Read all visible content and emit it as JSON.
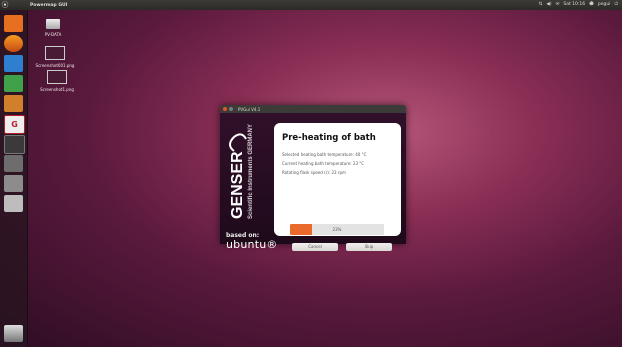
{
  "topbar": {
    "app_title": "Powermap GUI",
    "tray_text": "Sat 10:16",
    "user": "pegui"
  },
  "desktop_icons": [
    {
      "label": "PV-DATA"
    },
    {
      "label": "Screenshot001.png"
    },
    {
      "label": "Screenshot1.png"
    }
  ],
  "launcher": {
    "items": [
      {
        "name": "ubuntu-software-icon"
      },
      {
        "name": "firefox-icon"
      },
      {
        "name": "writer-icon"
      },
      {
        "name": "calc-icon"
      },
      {
        "name": "impress-icon"
      },
      {
        "name": "genser-app-icon",
        "glyph": "G"
      },
      {
        "name": "terminal-icon"
      },
      {
        "name": "settings-icon"
      },
      {
        "name": "update-icon"
      },
      {
        "name": "drive-icon"
      },
      {
        "name": "trash-icon"
      }
    ]
  },
  "dialog": {
    "title": "PVGui V4.1",
    "heading": "Pre-heating of bath",
    "lines": [
      "Selected heating bath temperature: 40 °C",
      "Current heating bath temperature: 23 °C",
      "Rotating flask speed (r): 23 rpm"
    ],
    "progress": {
      "percent_label": "23%",
      "value": 0.23
    },
    "cancel_label": "Cancel",
    "skip_label": "Skip",
    "brand": {
      "name": "GENSER",
      "tagline": "Scientific Instruments GERMANY",
      "based_on": "based on:",
      "ubuntu": "ubuntu"
    }
  },
  "colors": {
    "accent": "#e96a2b",
    "dialog_bg": "#2a0d22"
  }
}
